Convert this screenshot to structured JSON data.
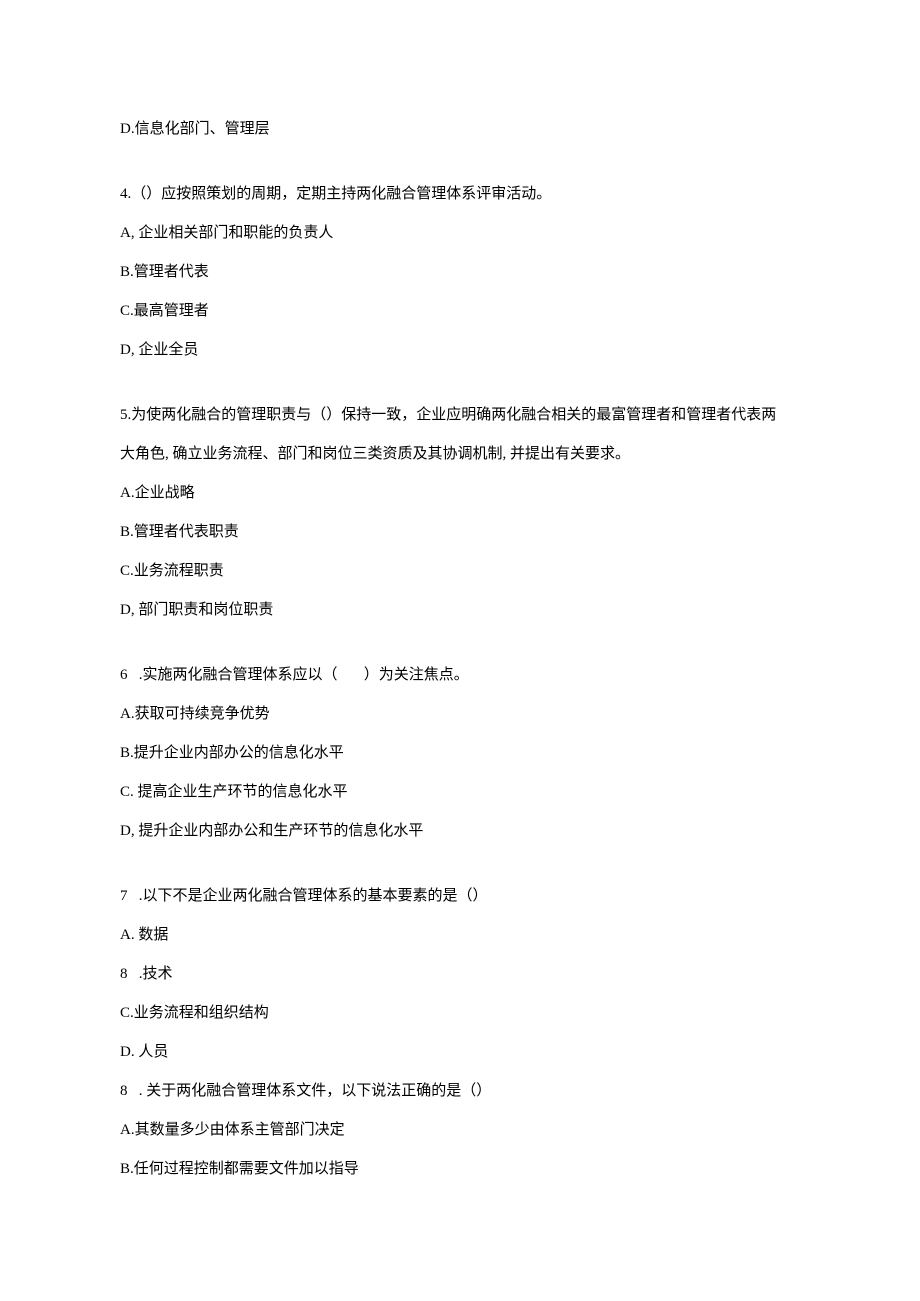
{
  "blocks": [
    {
      "lines": [
        "D.信息化部门、管理层"
      ]
    },
    {
      "lines": [
        "4.（）应按照策划的周期，定期主持两化融合管理体系评审活动。",
        "A, 企业相关部门和职能的负责人",
        "B.管理者代表",
        "C.最高管理者",
        "D, 企业全员"
      ]
    },
    {
      "lines": [
        "5.为使两化融合的管理职责与（）保持一致，企业应明确两化融合相关的最富管理者和管理者代表两",
        "大角色, 确立业务流程、部门和岗位三类资质及其协调机制, 并提出有关要求。",
        "A.企业战略",
        "B.管理者代表职责",
        "C.业务流程职责",
        "D, 部门职责和岗位职责"
      ]
    },
    {
      "lines": [
        "6   .实施两化融合管理体系应以（       ）为关注焦点。",
        "A.获取可持续竞争优势",
        "B.提升企业内部办公的信息化水平",
        "C. 提高企业生产环节的信息化水平",
        "D, 提升企业内部办公和生产环节的信息化水平"
      ]
    },
    {
      "lines": [
        "7   .以下不是企业两化融合管理体系的基本要素的是（）",
        "A. 数据",
        "8   .技术",
        "C.业务流程和组织结构",
        "D. 人员",
        "8   . 关于两化融合管理体系文件，以下说法正确的是（）",
        "A.其数量多少由体系主管部门决定",
        "B.任何过程控制都需要文件加以指导"
      ]
    }
  ]
}
